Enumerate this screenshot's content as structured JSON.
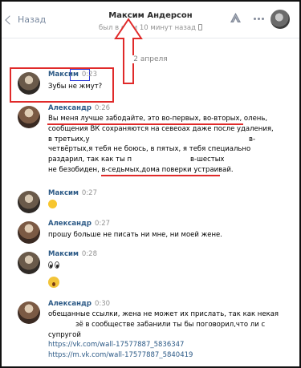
{
  "header": {
    "back_label": "Назад",
    "contact_name": "Максим Андерсон",
    "status": "был в сети 10 минут назад"
  },
  "date_separator": "2 апреля",
  "messages": [
    {
      "author": "Максим",
      "time": "0:23",
      "text": "Зубы не жмут?"
    },
    {
      "author": "Александр",
      "time": "0:26",
      "lines": [
        "Вы меня лучше забодайте, это во-первых, во-вторых, олень,",
        "сообщения ВК сохраняются на севеоах даже после удаления,",
        "в третьих,у",
        "четвёртых,я тебя не боюсь, в пятых, я тебя специально",
        "раздарил, так как ты п",
        "не безобиден, в-седьмых,дома поверки устраивай."
      ],
      "frag_v": "в-",
      "frag_shestyh": "в-шестых"
    },
    {
      "author": "Максим",
      "time": "0:27"
    },
    {
      "author": "Александр",
      "time": "0:27",
      "text": "прошу больше не писать ни мне, ни моей жене."
    },
    {
      "author": "Максим",
      "time": "0:28"
    },
    {
      "author": "Александр",
      "time": "0:30",
      "lines": [
        "обещанные ссылки, жена не может их прислать, так как некая",
        "зё в сообществе забанили ты бы поговорил,что ли с",
        "супругой"
      ],
      "links": [
        "https://vk.com/wall-17577887_5836347",
        "https://m.vk.com/wall-17577887_5840419"
      ]
    }
  ],
  "colors": {
    "annotation_red": "#e02a2a",
    "annotation_blue": "#2a3ad8",
    "link": "#2a5885"
  }
}
